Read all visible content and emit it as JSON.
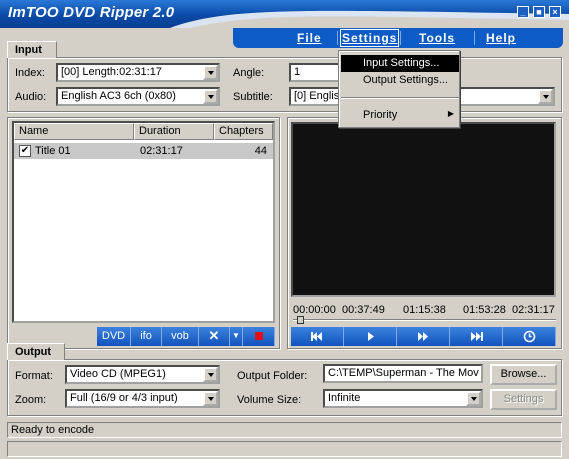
{
  "window": {
    "title": "ImTOO DVD Ripper  2.0",
    "controls": [
      "minimize-icon",
      "maximize-icon",
      "close-icon"
    ]
  },
  "menu": {
    "file": "File",
    "settings": "Settings",
    "tools": "Tools",
    "help": "Help"
  },
  "settings_menu": {
    "input_settings": "Input Settings...",
    "output_settings": "Output Settings...",
    "priority": "Priority"
  },
  "input": {
    "tab_label": "Input",
    "index_label": "Index:",
    "index_value": "[00] Length:02:31:17",
    "angle_label": "Angle:",
    "angle_value": "1",
    "audio_label": "Audio:",
    "audio_value": "English AC3 6ch (0x80)",
    "subtitle_label": "Subtitle:",
    "subtitle_value": "[0] English"
  },
  "list": {
    "columns": [
      "Name",
      "Duration",
      "Chapters"
    ],
    "rows": [
      {
        "checked": true,
        "name": "Title 01",
        "duration": "02:31:17",
        "chapters": "44"
      }
    ],
    "toolbar": {
      "dvd": "DVD",
      "ifo": "ifo",
      "vob": "vob"
    }
  },
  "preview": {
    "times": [
      "00:00:00",
      "00:37:49",
      "01:15:38",
      "01:53:28",
      "02:31:17"
    ],
    "position": 0
  },
  "output": {
    "tab_label": "Output",
    "format_label": "Format:",
    "format_value": "Video CD (MPEG1)",
    "zoom_label": "Zoom:",
    "zoom_value": "Full (16/9 or 4/3 input)",
    "folder_label": "Output Folder:",
    "folder_value": "C:\\TEMP\\Superman - The Mov",
    "browse_label": "Browse...",
    "volume_label": "Volume Size:",
    "volume_value": "Infinite",
    "settings_label": "Settings"
  },
  "status": {
    "message": "Ready to encode"
  },
  "colors": {
    "accent": "#0d5bc6",
    "window_bg": "#d4d0c8",
    "record": "#e01010"
  }
}
